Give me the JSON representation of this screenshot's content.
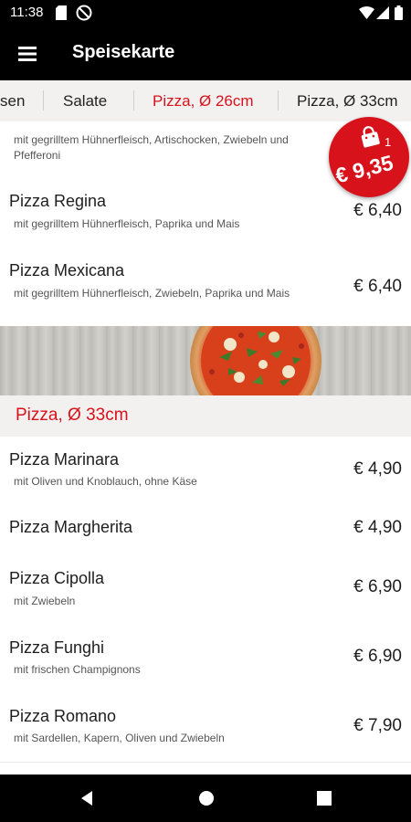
{
  "status_bar": {
    "time": "11:38",
    "icons": [
      "sd-card-icon",
      "do-not-disturb-icon",
      "wifi-icon",
      "signal-icon",
      "battery-icon"
    ]
  },
  "app_bar": {
    "title": "Speisekarte",
    "menu_icon": "hamburger-menu-icon"
  },
  "tabs": [
    {
      "label": "sen",
      "active": false
    },
    {
      "label": "Salate",
      "active": false
    },
    {
      "label": "Pizza, Ø 26cm",
      "active": true
    },
    {
      "label": "Pizza, Ø 33cm",
      "active": false
    }
  ],
  "cart": {
    "count": "1",
    "total": "€ 9,35",
    "icon": "shopping-bag-icon"
  },
  "menu_items_26": [
    {
      "name": "",
      "desc": "mit gegrilltem Hühnerfleisch, Artischocken, Zwiebeln und Pfefferoni",
      "price": ""
    },
    {
      "name": "Pizza Regina",
      "desc": "mit gegrilltem Hühnerfleisch, Paprika und Mais",
      "price": "€ 6,40"
    },
    {
      "name": "Pizza Mexicana",
      "desc": "mit gegrilltem Hühnerfleisch, Zwiebeln, Paprika und Mais",
      "price": "€ 6,40"
    }
  ],
  "section_33": {
    "title": "Pizza, Ø 33cm"
  },
  "menu_items_33": [
    {
      "name": "Pizza Marinara",
      "desc": "mit Oliven und Knoblauch, ohne Käse",
      "price": "€ 4,90"
    },
    {
      "name": "Pizza Margherita",
      "desc": "",
      "price": "€ 4,90"
    },
    {
      "name": "Pizza Cipolla",
      "desc": "mit Zwiebeln",
      "price": "€ 6,90"
    },
    {
      "name": "Pizza Funghi",
      "desc": "mit frischen Champignons",
      "price": "€ 6,90"
    },
    {
      "name": "Pizza Romano",
      "desc": "mit Sardellen, Kapern, Oliven und Zwiebeln",
      "price": "€ 7,90"
    }
  ],
  "colors": {
    "accent": "#d8121b",
    "tab_background": "#f2f1f0",
    "bars": "#000000"
  },
  "nav_bar": {
    "icons": [
      "back-icon",
      "home-icon",
      "recents-icon"
    ]
  }
}
